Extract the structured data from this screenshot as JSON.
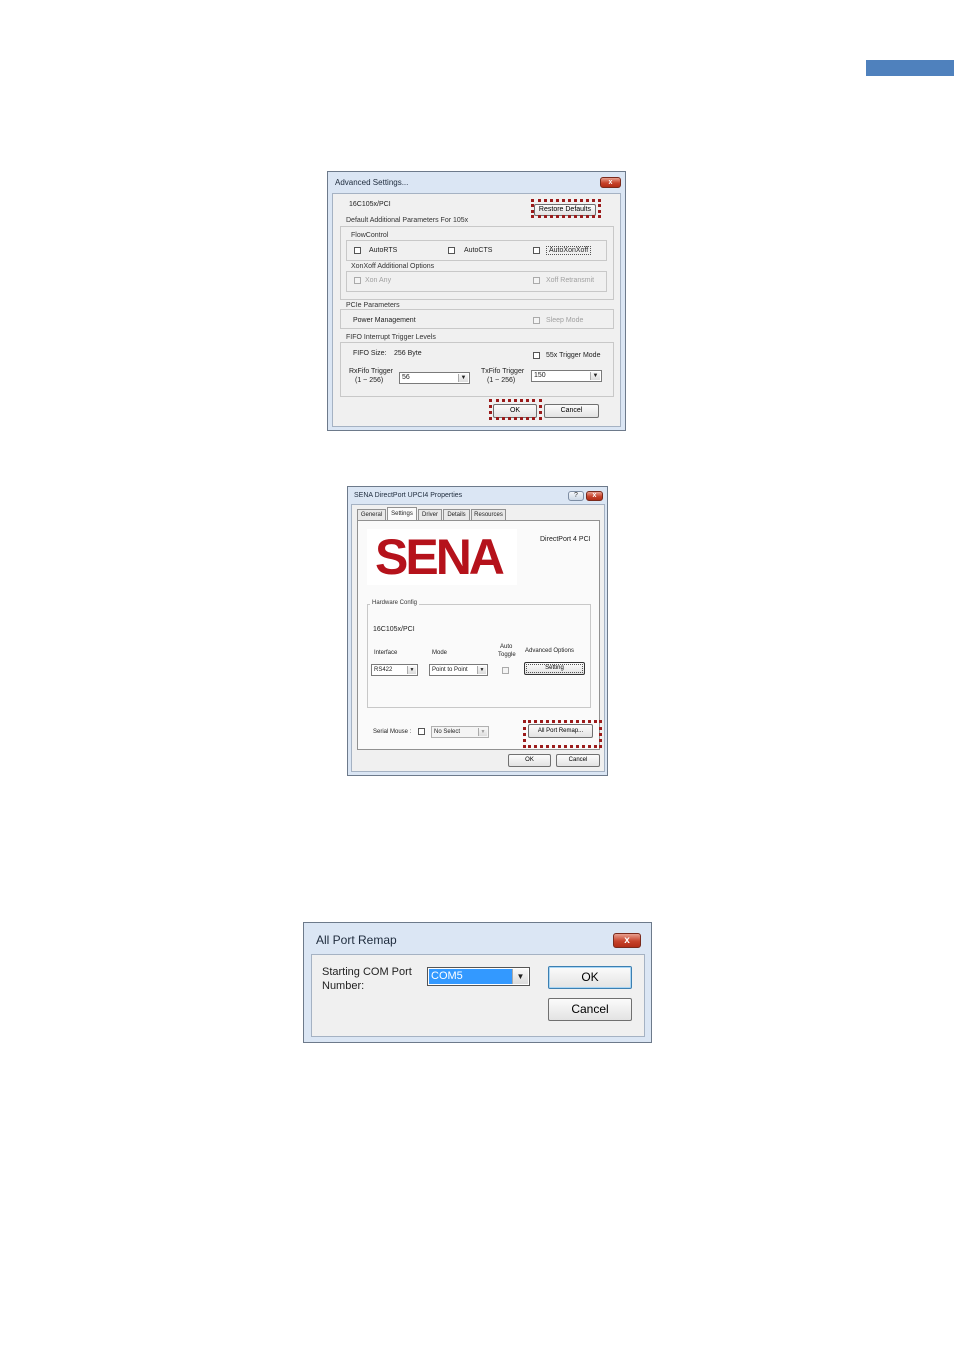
{
  "advanced": {
    "title": "Advanced Settings...",
    "close": "x",
    "chip": "16C105x/PCI",
    "restore_defaults": "Restore Defaults",
    "default_group": "Default Additional Parameters For 105x",
    "flow_group": "FlowControl",
    "auto_rts": "AutoRTS",
    "auto_cts": "AutoCTS",
    "auto_xonxoff": "AutoXonXoff",
    "xonxoff_group": "XonXoff Additional Options",
    "xon_any": "Xon Any",
    "xoff_retransmit": "Xoff Retransmit",
    "pcie_group": "PCIe Parameters",
    "power_mgmt": "Power Management",
    "sleep_mode": "Sleep Mode",
    "fifo_group": "FIFO Interrupt Trigger Levels",
    "fifo_size_label": "FIFO Size:",
    "fifo_size_value": "256 Byte",
    "trigger_mode": "55x Trigger Mode",
    "rx_label": "RxFifo Trigger",
    "rx_range": "(1 ~ 256)",
    "rx_value": "56",
    "tx_label": "TxFifo Trigger",
    "tx_range": "(1 ~ 256)",
    "tx_value": "150",
    "ok": "OK",
    "cancel": "Cancel"
  },
  "props": {
    "title": "SENA DirectPort UPCI4 Properties",
    "help": "?",
    "close": "x",
    "tabs": [
      "General",
      "Settings",
      "Driver",
      "Details",
      "Resources"
    ],
    "logo": "SENA",
    "model": "DirectPort 4 PCI",
    "hw_group": "Hardware Config",
    "chip": "16C105x/PCI",
    "interface_label": "Interface",
    "interface_value": "RS422",
    "mode_label": "Mode",
    "mode_value": "Point to Point",
    "auto_toggle_l1": "Auto",
    "auto_toggle_l2": "Toggle",
    "adv_label": "Advanced Options",
    "setting": "Setting",
    "serial_mouse": "Serial Mouse :",
    "serial_mouse_value": "No Select",
    "all_port_remap": "All Port Remap...",
    "ok": "OK",
    "cancel": "Cancel"
  },
  "remap": {
    "title": "All Port Remap",
    "close": "x",
    "label_l1": "Starting COM Port",
    "label_l2": "Number:",
    "com_value": "COM5",
    "ok": "OK",
    "cancel": "Cancel"
  },
  "colors": {
    "highlight": "#9b1b1b",
    "header_bar": "#4f81bd",
    "sena_red": "#b5121b"
  }
}
